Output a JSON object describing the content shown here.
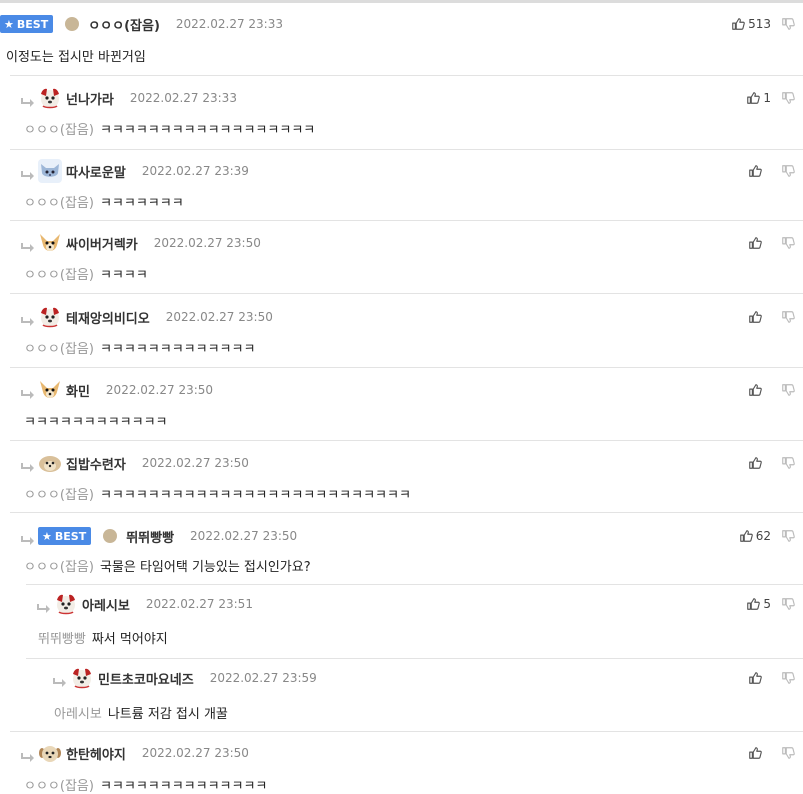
{
  "comments": [
    {
      "best": true,
      "best_label": "BEST",
      "avatar": "dot",
      "nick": "ㅇㅇㅇ(잡음)",
      "date": "2022.02.27 23:33",
      "likes": "513",
      "mention": "",
      "text": "이정도는 접시만 바뀐거임"
    },
    {
      "best": false,
      "avatar": "dog-red",
      "nick": "넌나가라",
      "date": "2022.02.27 23:33",
      "likes": "1",
      "mention": "ㅇㅇㅇ(잡음)",
      "text": "ㅋㅋㅋㅋㅋㅋㅋㅋㅋㅋㅋㅋㅋㅋㅋㅋㅋㅋ"
    },
    {
      "best": false,
      "avatar": "cat-blue",
      "nick": "따사로운말",
      "date": "2022.02.27 23:39",
      "likes": "",
      "mention": "ㅇㅇㅇ(잡음)",
      "text": "ㅋㅋㅋㅋㅋㅋㅋ"
    },
    {
      "best": false,
      "avatar": "dog-chihuahua",
      "nick": "싸이버거렉카",
      "date": "2022.02.27 23:50",
      "likes": "",
      "mention": "ㅇㅇㅇ(잡음)",
      "text": "ㅋㅋㅋㅋ"
    },
    {
      "best": false,
      "avatar": "dog-red",
      "nick": "테재앙의비디오",
      "date": "2022.02.27 23:50",
      "likes": "",
      "mention": "ㅇㅇㅇ(잡음)",
      "text": "ㅋㅋㅋㅋㅋㅋㅋㅋㅋㅋㅋㅋㅋ"
    },
    {
      "best": false,
      "avatar": "dog-chihuahua",
      "nick": "화민",
      "date": "2022.02.27 23:50",
      "likes": "",
      "mention": "",
      "text": "ㅋㅋㅋㅋㅋㅋㅋㅋㅋㅋㅋㅋ"
    },
    {
      "best": false,
      "avatar": "dog-beige",
      "nick": "집밥수련자",
      "date": "2022.02.27 23:50",
      "likes": "",
      "mention": "ㅇㅇㅇ(잡음)",
      "text": "ㅋㅋㅋㅋㅋㅋㅋㅋㅋㅋㅋㅋㅋㅋㅋㅋㅋㅋㅋㅋㅋㅋㅋㅋㅋㅋ"
    },
    {
      "best": true,
      "best_label": "BEST",
      "avatar": "dot",
      "nick": "뛰뛰빵빵",
      "date": "2022.02.27 23:50",
      "likes": "62",
      "mention": "ㅇㅇㅇ(잡음)",
      "text": "국물은 타임어택 기능있는 접시인가요?"
    },
    {
      "best": false,
      "avatar": "dog-red",
      "nick": "아레시보",
      "date": "2022.02.27 23:51",
      "likes": "5",
      "mention": "뛰뛰빵빵",
      "text": "짜서 먹어야지"
    },
    {
      "best": false,
      "avatar": "dog-red",
      "nick": "민트초코마요네즈",
      "date": "2022.02.27 23:59",
      "likes": "",
      "mention": "아레시보",
      "text": "나트륨 저감 접시 개꿀"
    },
    {
      "best": false,
      "avatar": "dog-beige2",
      "nick": "한탄헤야지",
      "date": "2022.02.27 23:50",
      "likes": "",
      "mention": "ㅇㅇㅇ(잡음)",
      "text": "ㅋㅋㅋㅋㅋㅋㅋㅋㅋㅋㅋㅋㅋㅋ"
    }
  ],
  "colors": {
    "best_badge": "#4a8ae6",
    "separator": "#e3e3e3",
    "mention": "#999999"
  }
}
